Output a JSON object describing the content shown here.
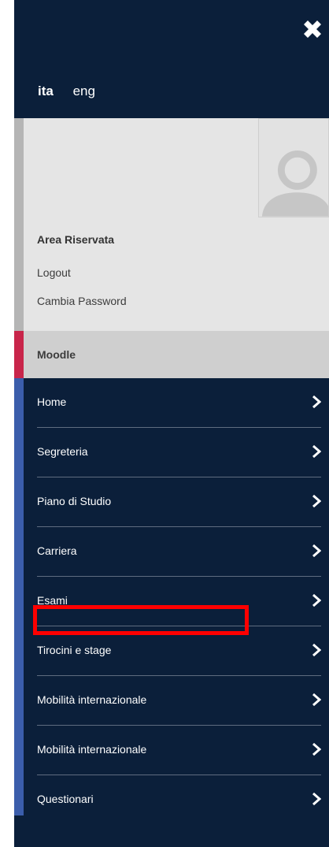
{
  "close": {
    "icon": "close-icon"
  },
  "languages": [
    {
      "label": "ita",
      "active": true
    },
    {
      "label": "eng",
      "active": false
    }
  ],
  "user": {
    "area_title": "Area Riservata",
    "logout": "Logout",
    "change_password": "Cambia Password",
    "avatar_icon": "user-avatar-icon"
  },
  "moodle": {
    "label": "Moodle"
  },
  "menu": {
    "items": [
      {
        "label": "Home"
      },
      {
        "label": "Segreteria"
      },
      {
        "label": "Piano di Studio"
      },
      {
        "label": "Carriera"
      },
      {
        "label": "Esami"
      },
      {
        "label": "Tirocini e stage"
      },
      {
        "label": "Mobilità internazionale"
      },
      {
        "label": "Mobilità internazionale"
      },
      {
        "label": "Questionari"
      }
    ],
    "chevron_icon": "chevron-right-icon"
  },
  "colors": {
    "panel_bg": "#0b1f3a",
    "user_box_bg": "#e5e5e5",
    "moodle_accent": "#c8254a",
    "menu_accent": "#3b5dab",
    "highlight": "#ff0000"
  }
}
